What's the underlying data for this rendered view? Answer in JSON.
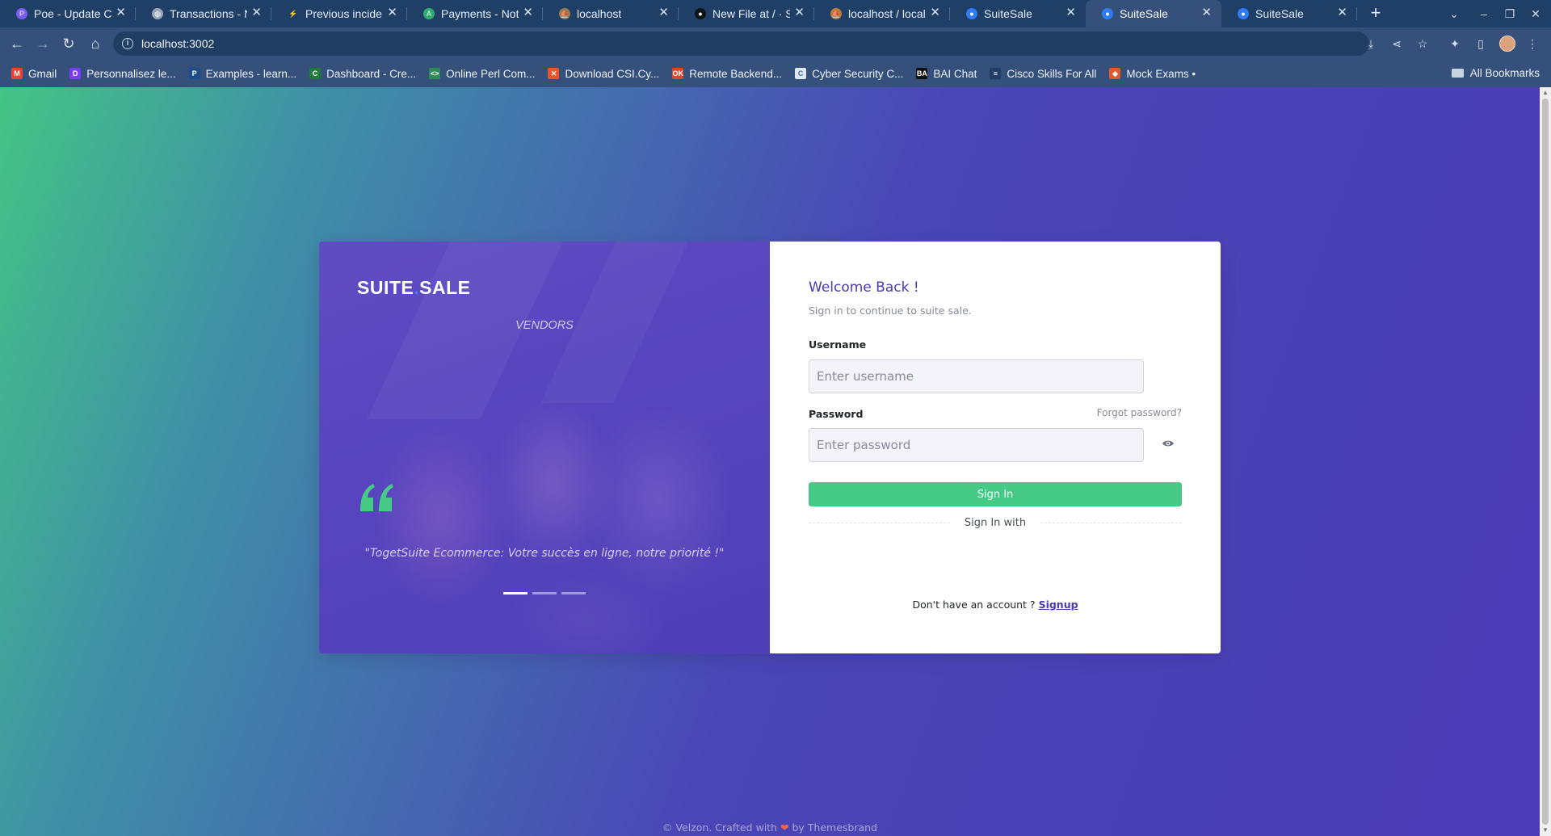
{
  "browser": {
    "tabs": [
      {
        "title": "Poe - Update Clie",
        "icon": "poe-icon",
        "color": "#7b5cf5",
        "glyph": "P"
      },
      {
        "title": "Transactions - No",
        "icon": "globe-icon",
        "color": "#9aa6b8",
        "glyph": "◍"
      },
      {
        "title": "Previous incident",
        "icon": "bolt-icon",
        "color": "#1f3f66",
        "glyph": "⚡"
      },
      {
        "title": "Payments - Notch",
        "icon": "notch-icon",
        "color": "#2fae6f",
        "glyph": "A"
      },
      {
        "title": "localhost",
        "icon": "phpmyadmin-icon",
        "color": "#9a7b4f",
        "glyph": "⛵"
      },
      {
        "title": "New File at / · Sec",
        "icon": "github-icon",
        "color": "#101418",
        "glyph": "●"
      },
      {
        "title": "localhost / localh",
        "icon": "phpmyadmin-icon",
        "color": "#c07b3a",
        "glyph": "⛵"
      },
      {
        "title": "SuiteSale",
        "icon": "suitesale-icon",
        "color": "#2f7df6",
        "glyph": "●"
      },
      {
        "title": "SuiteSale",
        "icon": "suitesale-icon",
        "color": "#2f7df6",
        "glyph": "●"
      },
      {
        "title": "SuiteSale",
        "icon": "suitesale-icon",
        "color": "#2f7df6",
        "glyph": "●"
      }
    ],
    "active_tab_index": 8,
    "url": "localhost:3002",
    "bookmarks": [
      {
        "label": "Gmail",
        "icon": "gmail-icon",
        "color": "#ea4335",
        "glyph": "M"
      },
      {
        "label": "Personnalisez le...",
        "icon": "canva-icon",
        "color": "#7a3df0",
        "glyph": "D"
      },
      {
        "label": "Examples - learn...",
        "icon": "p-icon",
        "color": "#1b4d8c",
        "glyph": "P"
      },
      {
        "label": "Dashboard - Cre...",
        "icon": "codewars-icon",
        "color": "#1f7a3b",
        "glyph": "C"
      },
      {
        "label": "Online Perl Com...",
        "icon": "perl-icon",
        "color": "#2e8b57",
        "glyph": "<>"
      },
      {
        "label": "Download CSI.Cy...",
        "icon": "x-icon",
        "color": "#e8552d",
        "glyph": "✕"
      },
      {
        "label": "Remote Backend...",
        "icon": "ok-icon",
        "color": "#e0452c",
        "glyph": "OK"
      },
      {
        "label": "Cyber Security C...",
        "icon": "doc-icon",
        "color": "#dfe9f5",
        "glyph": "C"
      },
      {
        "label": "BAI Chat",
        "icon": "bai-icon",
        "color": "#111111",
        "glyph": "BA"
      },
      {
        "label": "Cisco Skills For All",
        "icon": "cisco-icon",
        "color": "#1f3f66",
        "glyph": "≡"
      },
      {
        "label": "Mock Exams •",
        "icon": "shield-icon",
        "color": "#e4572e",
        "glyph": "◈"
      }
    ],
    "all_bookmarks": "All Bookmarks"
  },
  "login": {
    "logo_left": "SUITE",
    "logo_dot": ".",
    "logo_right": "SALE",
    "tagline": "VENDORS",
    "quote": "\"TogetSuite Ecommerce: Votre succès en ligne, notre priorité !\"",
    "carousel_active": 0,
    "welcome": "Welcome Back !",
    "subtitle": "Sign in to continue to suite sale.",
    "username_label": "Username",
    "username_placeholder": "Enter username",
    "password_label": "Password",
    "password_placeholder": "Enter password",
    "forgot": "Forgot password?",
    "sign_in": "Sign In",
    "sign_in_with": "Sign In with",
    "no_account": "Don't have an account ?",
    "signup": "Signup",
    "accent_color": "#45cb85",
    "brand_color": "#4b38b3"
  },
  "footer": {
    "prefix": "© Velzon. Crafted with",
    "heart": "❤",
    "suffix": "by Themesbrand"
  }
}
